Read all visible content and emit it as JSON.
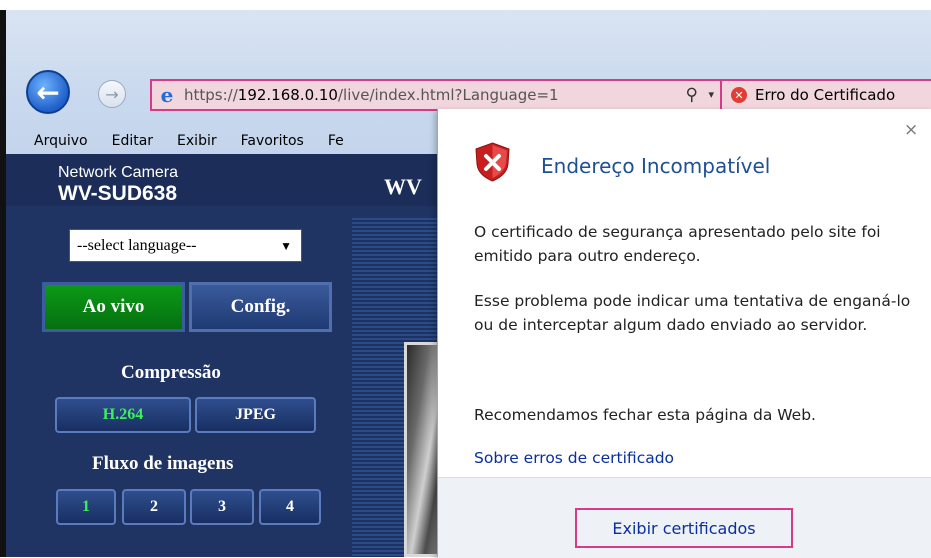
{
  "browser": {
    "back_icon": "←",
    "forward_icon": "→",
    "ie_icon": "e",
    "url_prefix": "https://",
    "url_host": "192.168.0.10",
    "url_path": "/live/index.html?Language=1",
    "search_icon": "⚲",
    "dropdown_icon": "▾",
    "cert_error_icon": "✕",
    "cert_error_label": "Erro do Certificado",
    "menu": [
      "Arquivo",
      "Editar",
      "Exibir",
      "Favoritos",
      "Fe"
    ]
  },
  "camera": {
    "brand_line": "Network Camera",
    "model": "WV-SUD638",
    "header_partial": "WV",
    "language_select": "--select language--",
    "live_button": "Ao vivo",
    "config_button": "Config.",
    "compression_label": "Compressão",
    "compression_options": [
      "H.264",
      "JPEG"
    ],
    "stream_label": "Fluxo de imagens",
    "stream_options": [
      "1",
      "2",
      "3",
      "4"
    ]
  },
  "popup": {
    "close_icon": "×",
    "title": "Endereço Incompatível",
    "para1": "O certificado de segurança apresentado pelo site foi emitido para outro endereço.",
    "para2": "Esse problema pode indicar uma tentativa de enganá-lo ou de interceptar algum dado enviado ao servidor.",
    "para3": "Recomendamos fechar esta página da Web.",
    "link": "Sobre erros de certificado",
    "view_button": "Exibir certificados"
  }
}
